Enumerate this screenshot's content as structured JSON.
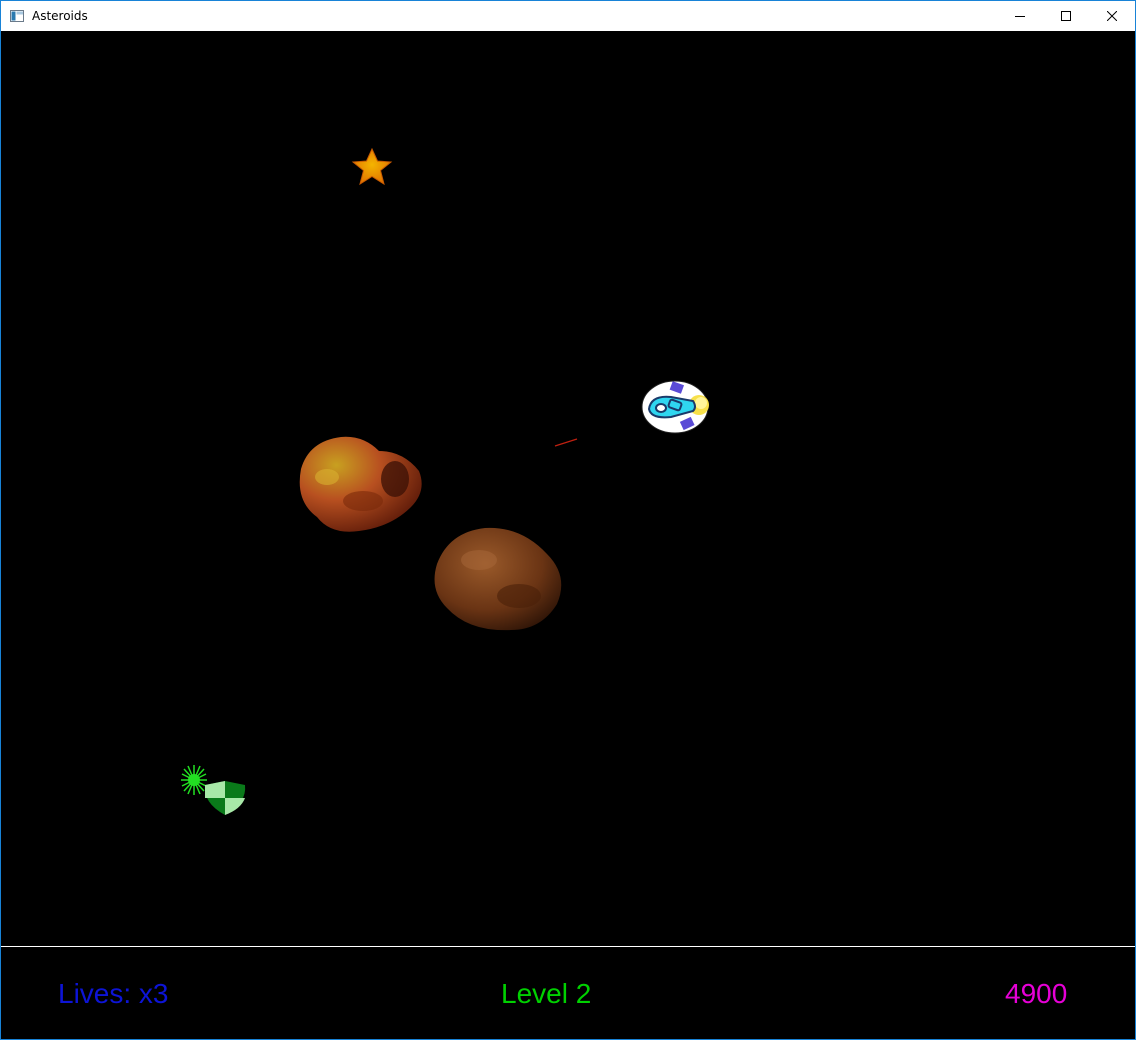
{
  "window": {
    "title": "Asteroids",
    "controls": [
      "minimize-icon",
      "maximize-icon",
      "close-icon"
    ]
  },
  "game": {
    "sprites": {
      "star": "star-pickup",
      "ship": "player-ship",
      "bullet": "laser-bullet",
      "asteroid_large_1": "asteroid-rocky-orange",
      "asteroid_large_2": "asteroid-rocky-brown",
      "shield": "shield-powerup",
      "burst": "green-burst"
    }
  },
  "hud": {
    "lives": "Lives: x3",
    "level": "Level 2",
    "score": "4900",
    "colors": {
      "lives": "#0d14d6",
      "level": "#00d100",
      "score": "#e600d6",
      "divider": "#ffffff"
    }
  }
}
